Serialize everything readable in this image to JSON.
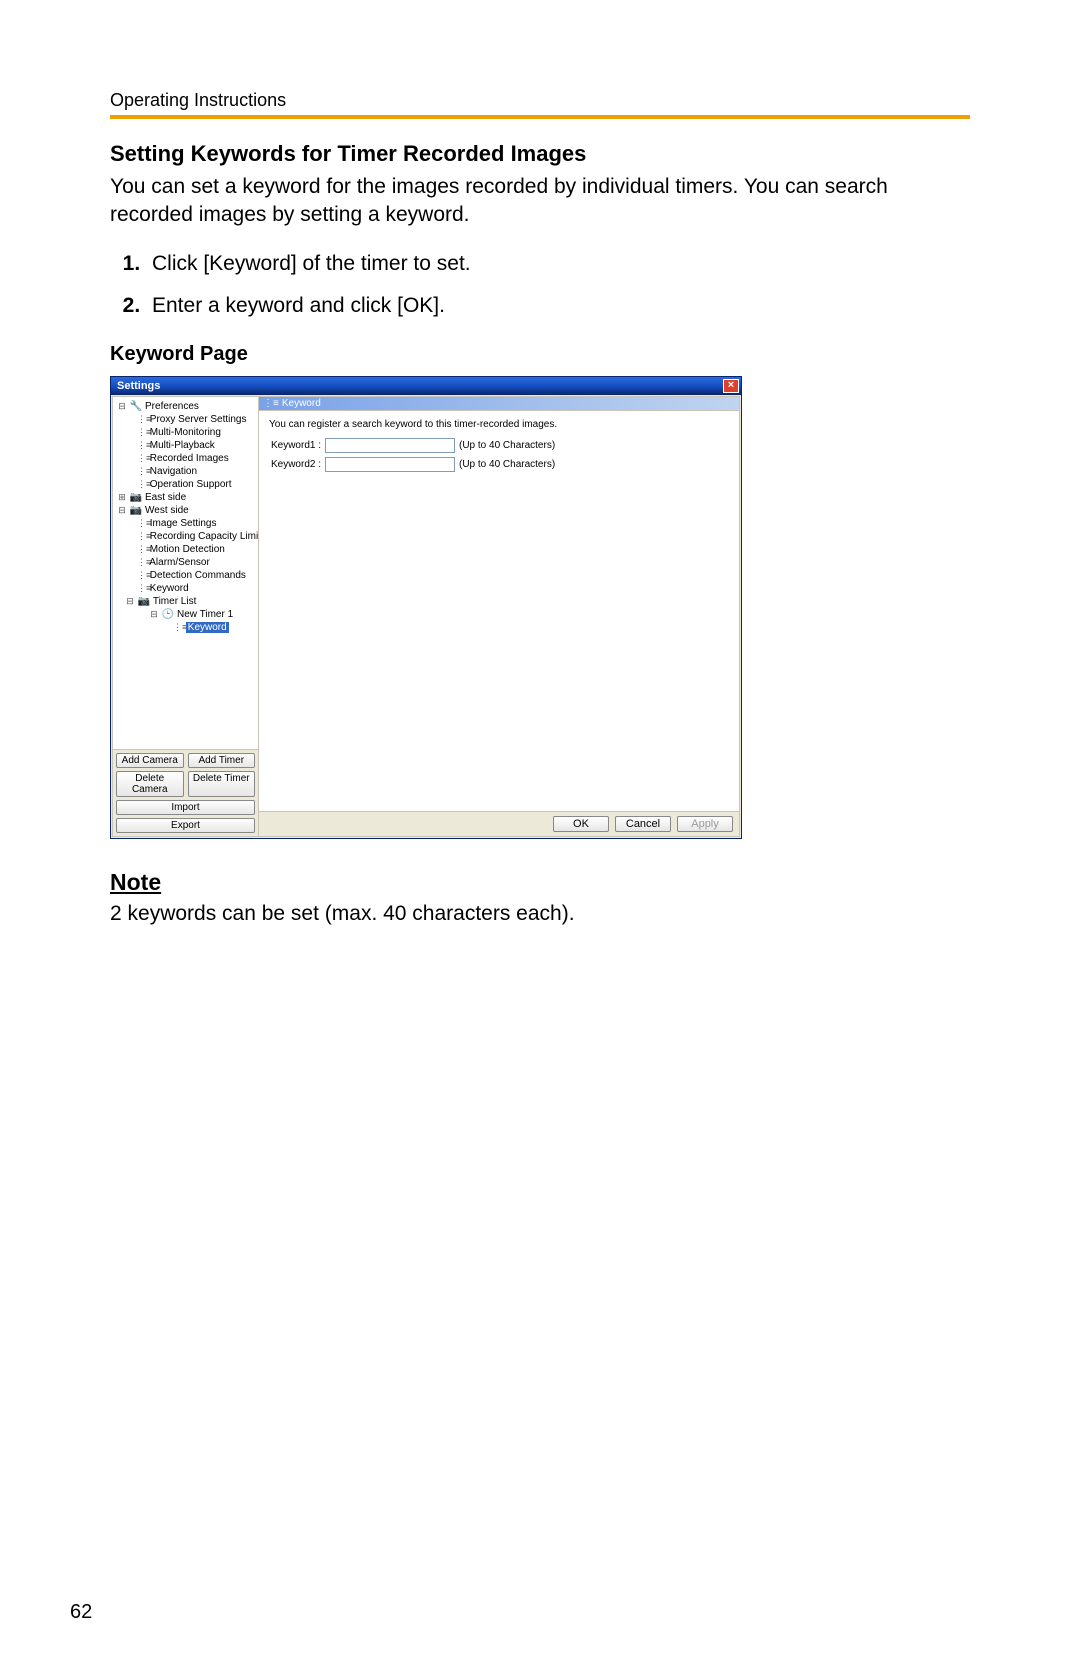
{
  "doc": {
    "header": "Operating Instructions",
    "page_number": "62",
    "section_title": "Setting Keywords for Timer Recorded Images",
    "intro": "You can set a keyword for the images recorded by individual timers. You can search recorded images by setting a keyword.",
    "steps": [
      "Click [Keyword] of the timer to set.",
      "Enter a keyword and click [OK]."
    ],
    "sub_title": "Keyword Page",
    "note_head": "Note",
    "note_body": "2 keywords can be set (max. 40 characters each)."
  },
  "window": {
    "title": "Settings",
    "close_glyph": "×",
    "tree": {
      "pref_root": "Preferences",
      "pref": [
        "Proxy Server Settings",
        "Multi-Monitoring",
        "Multi-Playback",
        "Recorded Images",
        "Navigation",
        "Operation Support"
      ],
      "east": "East side",
      "west": "West side",
      "west_items": [
        "Image Settings",
        "Recording Capacity Limit",
        "Motion Detection",
        "Alarm/Sensor",
        "Detection Commands",
        "Keyword"
      ],
      "timer_list": "Timer List",
      "new_timer": "New Timer 1",
      "timer_keyword": "Keyword"
    },
    "left_buttons": {
      "add_camera": "Add Camera",
      "add_timer": "Add Timer",
      "delete_camera": "Delete Camera",
      "delete_timer": "Delete Timer",
      "import": "Import",
      "export": "Export"
    },
    "panel": {
      "header": "Keyword",
      "desc": "You can register a search keyword to this timer-recorded images.",
      "k1_label": "Keyword1 :",
      "k2_label": "Keyword2 :",
      "k1_value": "",
      "k2_value": "",
      "hint": "(Up to 40 Characters)"
    },
    "dialog_buttons": {
      "ok": "OK",
      "cancel": "Cancel",
      "apply": "Apply"
    }
  }
}
